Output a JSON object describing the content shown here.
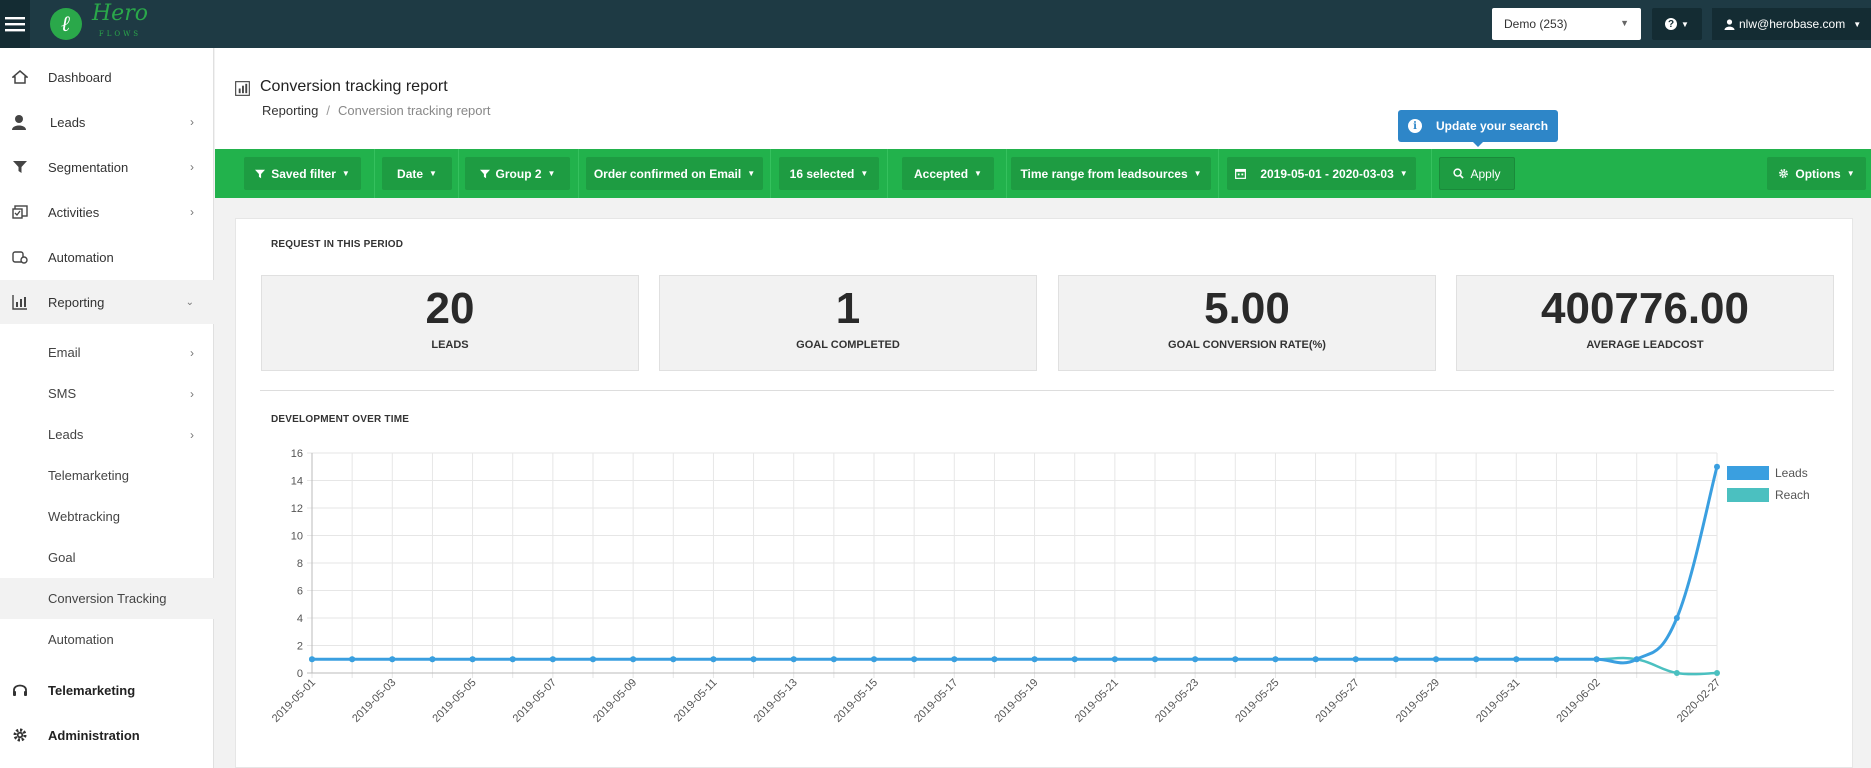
{
  "topbar": {
    "logo_text": "Hero",
    "logo_sub": "FLOWS",
    "account_select": "Demo (253)",
    "help_label": "?",
    "user_email": "nlw@herobase.com"
  },
  "sidebar": {
    "items": [
      {
        "label": "Dashboard",
        "icon": "home-icon"
      },
      {
        "label": "Leads",
        "icon": "user-icon"
      },
      {
        "label": "Segmentation",
        "icon": "filter-icon"
      },
      {
        "label": "Activities",
        "icon": "activities-icon"
      },
      {
        "label": "Automation",
        "icon": "automation-icon"
      },
      {
        "label": "Reporting",
        "icon": "reporting-icon"
      }
    ],
    "sub_items": [
      {
        "label": "Email"
      },
      {
        "label": "SMS"
      },
      {
        "label": "Leads"
      },
      {
        "label": "Telemarketing"
      },
      {
        "label": "Webtracking"
      },
      {
        "label": "Goal"
      },
      {
        "label": "Conversion Tracking"
      },
      {
        "label": "Automation"
      }
    ],
    "bottom_items": [
      {
        "label": "Telemarketing",
        "icon": "headset-icon"
      },
      {
        "label": "Administration",
        "icon": "gear-icon"
      }
    ]
  },
  "header": {
    "title": "Conversion tracking report",
    "breadcrumb_root": "Reporting",
    "breadcrumb_sep": "/",
    "breadcrumb_current": "Conversion tracking report"
  },
  "tooltip": "Update your search",
  "filters": {
    "saved_filter": "Saved filter",
    "date": "Date",
    "group": "Group 2",
    "order": "Order confirmed on Email",
    "selected": "16 selected",
    "accepted": "Accepted",
    "time_range": "Time range from leadsources",
    "date_range": "2019-05-01 - 2020-03-03",
    "apply": "Apply",
    "options": "Options"
  },
  "period": {
    "label": "REQUEST IN THIS PERIOD",
    "stats": [
      {
        "value": "20",
        "label": "LEADS"
      },
      {
        "value": "1",
        "label": "GOAL COMPLETED"
      },
      {
        "value": "5.00",
        "label": "GOAL CONVERSION RATE(%)"
      },
      {
        "value": "400776.00",
        "label": "AVERAGE LEADCOST"
      }
    ]
  },
  "development_label": "DEVELOPMENT OVER TIME",
  "chart_data": {
    "type": "line",
    "x": [
      "2019-05-01",
      "2019-05-02",
      "2019-05-03",
      "2019-05-04",
      "2019-05-05",
      "2019-05-06",
      "2019-05-07",
      "2019-05-08",
      "2019-05-09",
      "2019-05-10",
      "2019-05-11",
      "2019-05-12",
      "2019-05-13",
      "2019-05-14",
      "2019-05-15",
      "2019-05-16",
      "2019-05-17",
      "2019-05-18",
      "2019-05-19",
      "2019-05-20",
      "2019-05-21",
      "2019-05-22",
      "2019-05-23",
      "2019-05-24",
      "2019-05-25",
      "2019-05-26",
      "2019-05-27",
      "2019-05-28",
      "2019-05-29",
      "2019-05-30",
      "2019-05-31",
      "2019-06-01",
      "2019-06-02",
      "2019-06-03",
      "2020-02-26",
      "2020-02-27"
    ],
    "x_tick_labels": [
      "2019-05-01",
      "2019-05-03",
      "2019-05-05",
      "2019-05-07",
      "2019-05-09",
      "2019-05-11",
      "2019-05-13",
      "2019-05-15",
      "2019-05-17",
      "2019-05-19",
      "2019-05-21",
      "2019-05-23",
      "2019-05-25",
      "2019-05-27",
      "2019-05-29",
      "2019-05-31",
      "2019-06-02",
      "2020-02-27"
    ],
    "series": [
      {
        "name": "Leads",
        "color": "#3a9fe0",
        "values": [
          1,
          1,
          1,
          1,
          1,
          1,
          1,
          1,
          1,
          1,
          1,
          1,
          1,
          1,
          1,
          1,
          1,
          1,
          1,
          1,
          1,
          1,
          1,
          1,
          1,
          1,
          1,
          1,
          1,
          1,
          1,
          1,
          1,
          1,
          4,
          15
        ]
      },
      {
        "name": "Reach",
        "color": "#4bc0c0",
        "values": [
          1,
          1,
          1,
          1,
          1,
          1,
          1,
          1,
          1,
          1,
          1,
          1,
          1,
          1,
          1,
          1,
          1,
          1,
          1,
          1,
          1,
          1,
          1,
          1,
          1,
          1,
          1,
          1,
          1,
          1,
          1,
          1,
          1,
          1,
          0,
          0
        ]
      }
    ],
    "ylim": [
      0,
      16
    ],
    "y_ticks": [
      0,
      2,
      4,
      6,
      8,
      10,
      12,
      14,
      16
    ],
    "grid": true,
    "legend": "top-right"
  }
}
